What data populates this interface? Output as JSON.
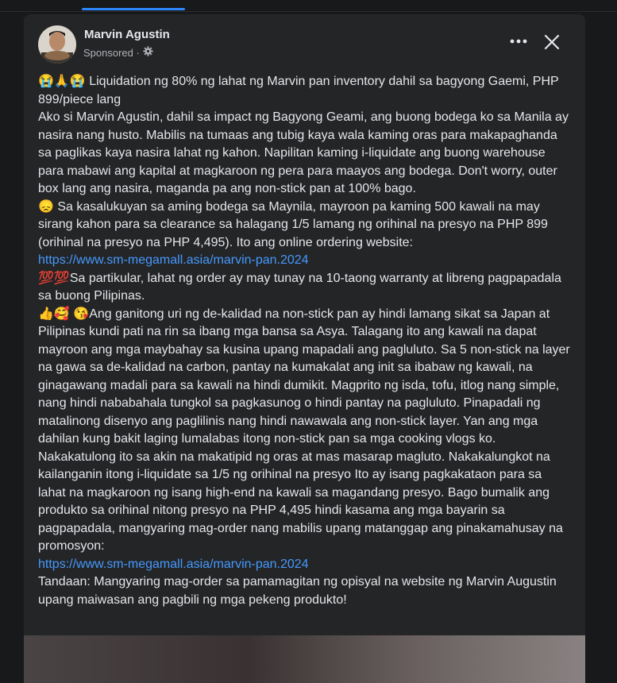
{
  "post": {
    "author": "Marvin Agustin",
    "sponsored_label": "Sponsored ·",
    "paragraphs": [
      {
        "emoji": "😭🙏😭",
        "text": " Liquidation ng 80% ng lahat ng Marvin pan inventory dahil sa bagyong Gaemi, PHP 899/piece lang"
      },
      {
        "emoji": "",
        "text": "Ako si Marvin Agustin, dahil sa impact ng Bagyong Geami, ang buong bodega ko sa Manila ay nasira nang husto. Mabilis na tumaas ang tubig kaya wala kaming oras para makapaghanda sa paglikas kaya nasira lahat ng kahon. Napilitan kaming i-liquidate ang buong warehouse para mabawi ang kapital at magkaroon ng pera para maayos ang bodega. Don't worry, outer box lang ang nasira, maganda pa ang non-stick pan at 100% bago."
      },
      {
        "emoji": "😞",
        "text": " Sa kasalukuyan sa aming bodega sa Maynila, mayroon pa kaming 500 kawali na may sirang kahon para sa clearance sa halagang 1/5 lamang ng orihinal na presyo na PHP 899 (orihinal na presyo na PHP 4,495). Ito ang online ordering website:"
      },
      {
        "link": "https://www.sm-megamall.asia/marvin-pan.2024"
      },
      {
        "emoji": "💯💯",
        "text": "Sa partikular, lahat ng order ay may tunay na 10-taong warranty at libreng pagpapadala sa buong Pilipinas."
      },
      {
        "emoji": "👍🥰 😘",
        "text": "Ang ganitong uri ng de-kalidad na non-stick pan ay hindi lamang sikat sa Japan at Pilipinas kundi pati na rin sa ibang mga bansa sa Asya. Talagang ito ang kawali na dapat mayroon ang mga maybahay sa kusina upang mapadali ang pagluluto. Sa 5 non-stick na layer na gawa sa de-kalidad na carbon, pantay na kumakalat ang init sa ibabaw ng kawali, na ginagawang madali para sa kawali na hindi dumikit. Magprito ng isda, tofu, itlog nang simple, nang hindi nababahala tungkol sa pagkasunog o hindi pantay na pagluluto. Pinapadali ng matalinong disenyo ang paglilinis nang hindi nawawala ang non-stick layer. Yan ang mga dahilan kung bakit laging lumalabas itong non-stick pan sa mga cooking vlogs ko. Nakakatulong ito sa akin na makatipid ng oras at mas masarap magluto. Nakakalungkot na kailanganin itong i-liquidate sa 1/5 ng orihinal na presyo Ito ay isang pagkakataon para sa lahat na magkaroon ng isang high-end na kawali sa magandang presyo. Bago bumalik ang produkto sa orihinal nitong presyo na PHP 4,495  hindi kasama ang mga bayarin sa pagpapadala, mangyaring mag-order nang mabilis upang matanggap ang pinakamahusay na promosyon:"
      },
      {
        "link": "https://www.sm-megamall.asia/marvin-pan.2024"
      },
      {
        "emoji": "",
        "text": "Tandaan: Mangyaring mag-order sa pamamagitan ng opisyal na website ng Marvin Augustin upang maiwasan ang pagbili ng mga pekeng produkto!"
      }
    ]
  },
  "icons": {
    "more": "more-options-icon",
    "close": "close-icon",
    "privacy": "gear-icon"
  },
  "colors": {
    "background": "#18191a",
    "card": "#242526",
    "link": "#4599ff",
    "accent": "#2d88ff"
  }
}
